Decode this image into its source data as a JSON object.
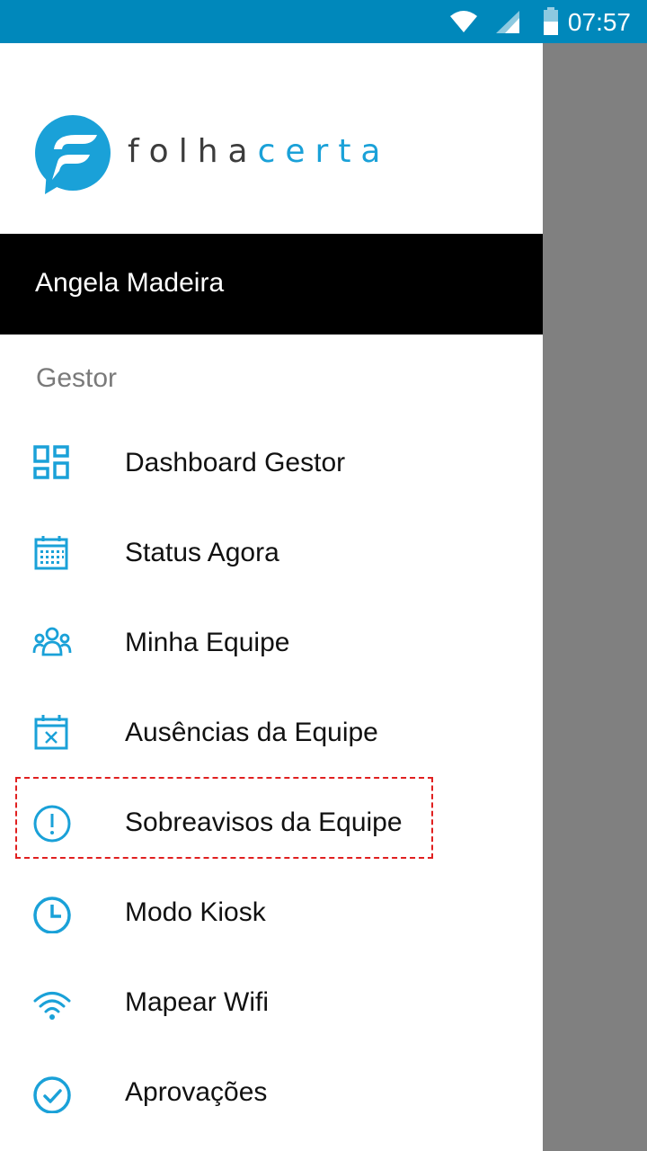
{
  "status_bar": {
    "time": "07:57"
  },
  "brand": {
    "part1": "folha",
    "part2": "certa"
  },
  "user": {
    "name": "Angela Madeira"
  },
  "section": {
    "label": "Gestor"
  },
  "menu": [
    {
      "label": "Dashboard Gestor",
      "icon": "dashboard-icon"
    },
    {
      "label": "Status Agora",
      "icon": "calendar-icon"
    },
    {
      "label": "Minha Equipe",
      "icon": "team-icon"
    },
    {
      "label": "Ausências da Equipe",
      "icon": "calendar-x-icon"
    },
    {
      "label": "Sobreavisos da Equipe",
      "icon": "alert-circle-icon"
    },
    {
      "label": "Modo Kiosk",
      "icon": "clock-icon"
    },
    {
      "label": "Mapear Wifi",
      "icon": "wifi-icon"
    },
    {
      "label": "Aprovações",
      "icon": "check-circle-icon"
    }
  ],
  "colors": {
    "accent": "#1aa1d8",
    "statusbar": "#0088bb",
    "highlight": "#e02020"
  }
}
